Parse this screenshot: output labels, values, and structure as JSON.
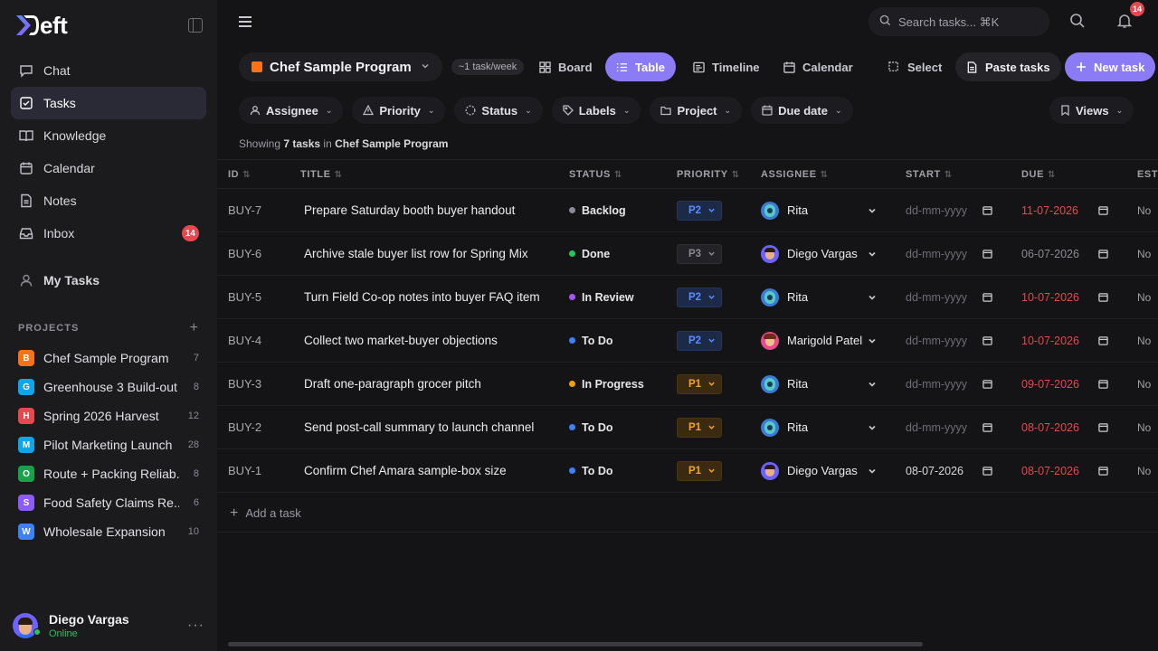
{
  "app": {
    "logo_text": "eft"
  },
  "sidebar": {
    "nav": [
      {
        "label": "Chat",
        "icon": "chat-icon"
      },
      {
        "label": "Tasks",
        "icon": "tasks-icon",
        "active": true
      },
      {
        "label": "Knowledge",
        "icon": "book-icon"
      },
      {
        "label": "Calendar",
        "icon": "calendar-icon"
      },
      {
        "label": "Notes",
        "icon": "notes-icon"
      },
      {
        "label": "Inbox",
        "icon": "inbox-icon",
        "badge": "14"
      }
    ],
    "my_tasks": "My Tasks",
    "projects_heading": "PROJECTS",
    "projects": [
      {
        "letter": "B",
        "name": "Chef Sample Program",
        "count": "7",
        "color": "#f97316"
      },
      {
        "letter": "G",
        "name": "Greenhouse 3 Build-out",
        "count": "8",
        "color": "#0ea5e9"
      },
      {
        "letter": "H",
        "name": "Spring 2026 Harvest",
        "count": "12",
        "color": "#e5484d"
      },
      {
        "letter": "M",
        "name": "Pilot Marketing Launch",
        "count": "28",
        "color": "#0ea5e9"
      },
      {
        "letter": "O",
        "name": "Route + Packing Reliab...",
        "count": "8",
        "color": "#16a34a"
      },
      {
        "letter": "S",
        "name": "Food Safety Claims Re...",
        "count": "6",
        "color": "#8b5cf6"
      },
      {
        "letter": "W",
        "name": "Wholesale Expansion",
        "count": "10",
        "color": "#3b82f6"
      }
    ],
    "user": {
      "name": "Diego Vargas",
      "status": "Online"
    }
  },
  "topbar": {
    "search_placeholder": "Search tasks... ⌘K",
    "notif_count": "14"
  },
  "toolbar": {
    "program": "Chef Sample Program",
    "rate": "~1 task/week",
    "views": {
      "board": "Board",
      "table": "Table",
      "timeline": "Timeline",
      "calendar": "Calendar",
      "select": "Select",
      "paste": "Paste tasks",
      "new_task": "New task"
    }
  },
  "filters": {
    "assignee": "Assignee",
    "priority": "Priority",
    "status": "Status",
    "labels": "Labels",
    "project": "Project",
    "due_date": "Due date",
    "views": "Views"
  },
  "showing": {
    "prefix": "Showing",
    "count": "7 tasks",
    "mid": "in",
    "project": "Chef Sample Program"
  },
  "table": {
    "columns": [
      "ID",
      "TITLE",
      "STATUS",
      "PRIORITY",
      "ASSIGNEE",
      "START",
      "DUE",
      "ESTI"
    ],
    "rows": [
      {
        "id": "BUY-7",
        "title": "Prepare Saturday booth buyer handout",
        "status": "Backlog",
        "status_color": "#8a8a94",
        "priority": "P2",
        "assignee": "Rita",
        "av": "rita",
        "start": "dd-mm-yyyy",
        "start_kind": "ph",
        "due": "11-07-2026",
        "due_kind": "overdue",
        "est": "No"
      },
      {
        "id": "BUY-6",
        "title": "Archive stale buyer list row for Spring Mix",
        "status": "Done",
        "status_color": "#22c55e",
        "priority": "P3",
        "assignee": "Diego Vargas",
        "av": "diego",
        "start": "dd-mm-yyyy",
        "start_kind": "ph",
        "due": "06-07-2026",
        "due_kind": "muted",
        "est": "No"
      },
      {
        "id": "BUY-5",
        "title": "Turn Field Co-op notes into buyer FAQ item",
        "status": "In Review",
        "status_color": "#a855f7",
        "priority": "P2",
        "assignee": "Rita",
        "av": "rita",
        "start": "dd-mm-yyyy",
        "start_kind": "ph",
        "due": "10-07-2026",
        "due_kind": "overdue",
        "est": "No"
      },
      {
        "id": "BUY-4",
        "title": "Collect two market-buyer objections",
        "status": "To Do",
        "status_color": "#3b82f6",
        "priority": "P2",
        "assignee": "Marigold Patel",
        "av": "marigold",
        "start": "dd-mm-yyyy",
        "start_kind": "ph",
        "due": "10-07-2026",
        "due_kind": "overdue",
        "est": "No"
      },
      {
        "id": "BUY-3",
        "title": "Draft one-paragraph grocer pitch",
        "status": "In Progress",
        "status_color": "#f59e0b",
        "priority": "P1",
        "assignee": "Rita",
        "av": "rita",
        "start": "dd-mm-yyyy",
        "start_kind": "ph",
        "due": "09-07-2026",
        "due_kind": "overdue",
        "est": "No"
      },
      {
        "id": "BUY-2",
        "title": "Send post-call summary to launch channel",
        "status": "To Do",
        "status_color": "#3b82f6",
        "priority": "P1",
        "assignee": "Rita",
        "av": "rita",
        "start": "dd-mm-yyyy",
        "start_kind": "ph",
        "due": "08-07-2026",
        "due_kind": "overdue",
        "est": "No"
      },
      {
        "id": "BUY-1",
        "title": "Confirm Chef Amara sample-box size",
        "status": "To Do",
        "status_color": "#3b82f6",
        "priority": "P1",
        "assignee": "Diego Vargas",
        "av": "diego",
        "start": "08-07-2026",
        "start_kind": "set",
        "due": "08-07-2026",
        "due_kind": "overdue",
        "est": "No"
      }
    ],
    "add_task": "Add a task"
  }
}
